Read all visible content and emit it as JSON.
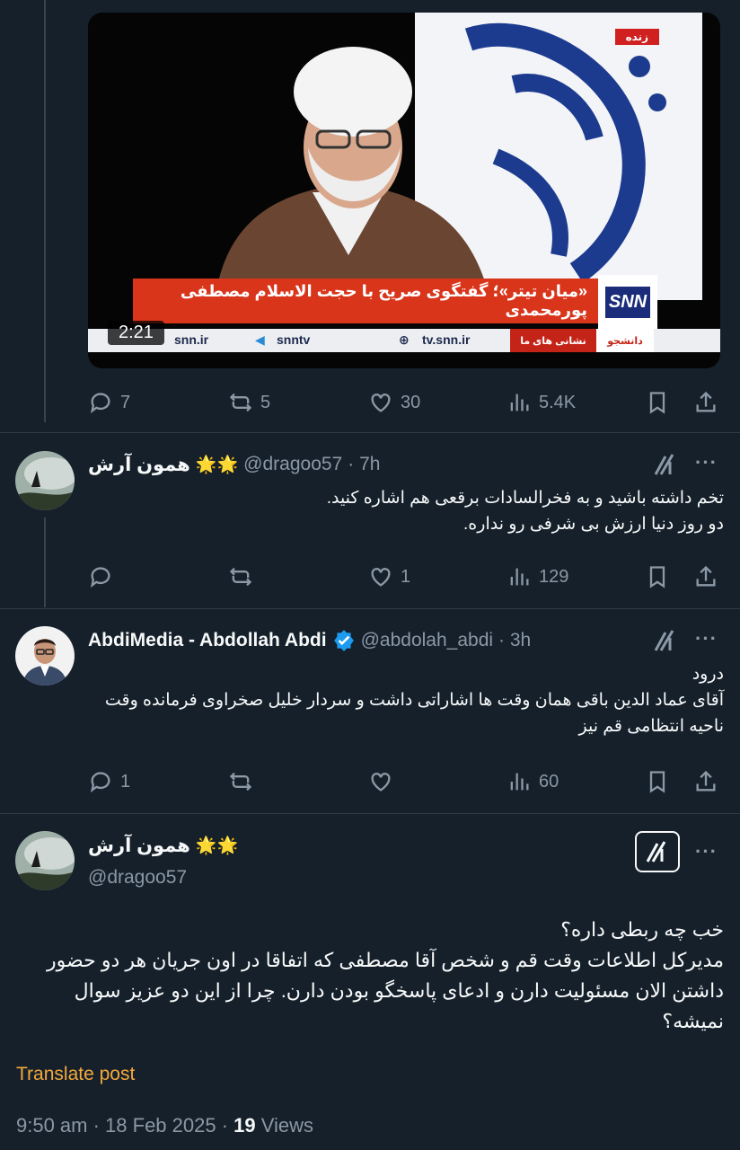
{
  "video": {
    "duration": "2:21",
    "live_badge": "زنده",
    "caption": "«میان تیتر»؛ گفتگوی صریح با حجت الاسلام مصطفی پورمحمدی",
    "channel_logo": "SNN",
    "ticker_site1": "snn.ir",
    "ticker_social": "snntv",
    "ticker_site2": "tv.snn.ir",
    "ticker_label": "نشانی های ما",
    "ticker_brand": "دانشجو"
  },
  "main_post_actions": {
    "replies": "7",
    "reposts": "5",
    "likes": "30",
    "views": "5.4K"
  },
  "reply1": {
    "name": "همون آرش",
    "emoji": "🌟🌟",
    "handle": "@dragoo57",
    "time": "· 7h",
    "line1": "تخم داشته باشید و به فخرالسادات برقعی هم اشاره کنید.",
    "line2": "دو روز دنیا ارزش بی شرفی رو نداره.",
    "actions": {
      "replies": "",
      "reposts": "",
      "likes": "1",
      "views": "129"
    }
  },
  "reply2": {
    "name": "AbdiMedia - Abdollah Abdi",
    "handle": "@abdolah_abdi",
    "time": "· 3h",
    "line1": "درود",
    "line2": "آقای عماد الدین باقی همان وقت ها اشاراتی داشت و سردار خلیل صخراوی فرمانده وقت",
    "line3": "ناحیه انتظامی قم نیز",
    "actions": {
      "replies": "1",
      "reposts": "",
      "likes": "",
      "views": "60"
    }
  },
  "main_post": {
    "name": "همون آرش",
    "emoji": "🌟🌟",
    "handle": "@dragoo57",
    "line1": "خب چه ربطی داره؟",
    "line2": "مدیرکل اطلاعات وقت قم و شخص آقا مصطفی که اتفاقا در اون جریان هر دو حضور",
    "line3": "داشتن الان مسئولیت دارن و ادعای پاسخگو بودن دارن. چرا از این دو عزیز سوال",
    "line4": "نمیشه؟",
    "translate": "Translate post",
    "timestamp": "9:50 am · 18 Feb 2025 ·",
    "views_count": "19",
    "views_label": "Views"
  },
  "icons": [
    "reply-icon",
    "repost-icon",
    "like-icon",
    "views-icon",
    "bookmark-icon",
    "share-icon",
    "grok-icon",
    "more-icon",
    "verified-icon"
  ],
  "colors": {
    "background": "#15202b",
    "text": "#f7f9f9",
    "muted": "#8b98a5",
    "translate": "#f3a93b",
    "verified": "#1d9bf0"
  }
}
